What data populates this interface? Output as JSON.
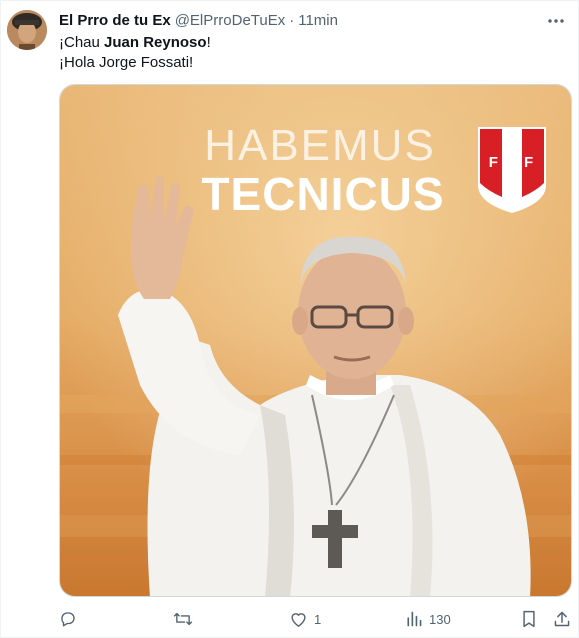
{
  "tweet": {
    "display_name": "El Prro de tu Ex",
    "handle": "@ElPrroDeTuEx",
    "separator": "·",
    "time": "11min",
    "line1_prefix": "¡Chau ",
    "line1_bold": "Juan Reynoso",
    "line1_suffix": "!",
    "line2": "¡Hola Jorge Fossati!"
  },
  "media": {
    "headline_1": "HABEMUS",
    "headline_2": "TECNICUS",
    "badge_text": "F P F"
  },
  "actions": {
    "reply_icon": "reply-icon",
    "retweet_icon": "retweet-icon",
    "like_icon": "heart-icon",
    "like_count": "1",
    "views_icon": "views-icon",
    "views_count": "130",
    "bookmark_icon": "bookmark-icon",
    "share_icon": "share-icon"
  },
  "colors": {
    "text_primary": "#0f1419",
    "text_secondary": "#536471",
    "badge_red": "#d91f26"
  }
}
